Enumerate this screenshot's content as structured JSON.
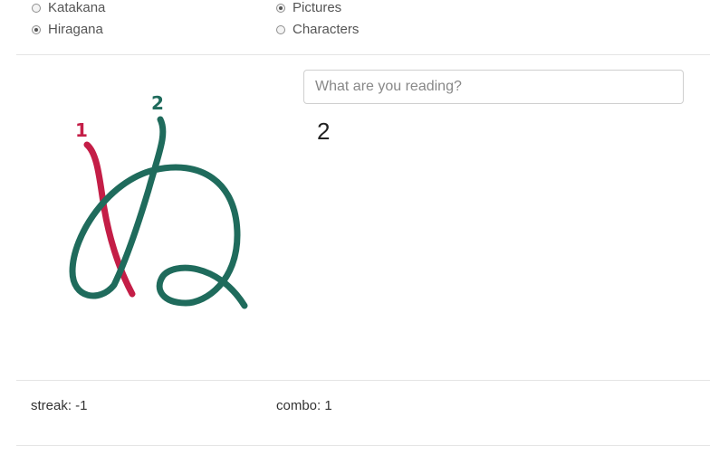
{
  "options": {
    "katakana": {
      "label": "Katakana",
      "checked": false
    },
    "hiragana": {
      "label": "Hiragana",
      "checked": true
    },
    "pictures": {
      "label": "Pictures",
      "checked": true
    },
    "characters": {
      "label": "Characters",
      "checked": false
    }
  },
  "drawing": {
    "stroke1_number": "1",
    "stroke2_number": "2",
    "stroke1_color": "#c41e47",
    "stroke2_color": "#1f6b5c"
  },
  "input": {
    "placeholder": "What are you reading?",
    "value": ""
  },
  "answer": "2",
  "stats": {
    "streak": "streak: -1",
    "combo": "combo: 1"
  }
}
